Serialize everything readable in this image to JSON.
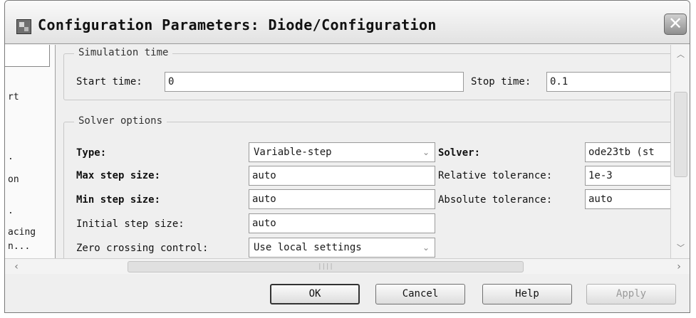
{
  "window": {
    "title": "Configuration Parameters: Diode/Configuration",
    "close_glyph": "✕"
  },
  "left_pane": {
    "items": [
      "rt",
      ".",
      "on",
      ".",
      "acing",
      "n..."
    ]
  },
  "simulation_time": {
    "group_label": "Simulation time",
    "start_label": "Start time:",
    "start_value": "0",
    "stop_label": "Stop time:",
    "stop_value": "0.1"
  },
  "solver_options": {
    "group_label": "Solver options",
    "type_label": "Type:",
    "type_value": "Variable-step",
    "solver_label": "Solver:",
    "solver_value": "ode23tb (st",
    "max_step_label": "Max step size:",
    "max_step_value": "auto",
    "rel_tol_label": "Relative tolerance:",
    "rel_tol_value": "1e-3",
    "min_step_label": "Min step size:",
    "min_step_value": "auto",
    "abs_tol_label": "Absolute tolerance:",
    "abs_tol_value": "auto",
    "init_step_label": "Initial step size:",
    "init_step_value": "auto",
    "zero_crossing_label": "Zero crossing control:",
    "zero_crossing_value": "Use local settings"
  },
  "buttons": {
    "ok": "OK",
    "cancel": "Cancel",
    "help": "Help",
    "apply": "Apply"
  },
  "scrollbar": {
    "grip_glyph": "||||"
  }
}
